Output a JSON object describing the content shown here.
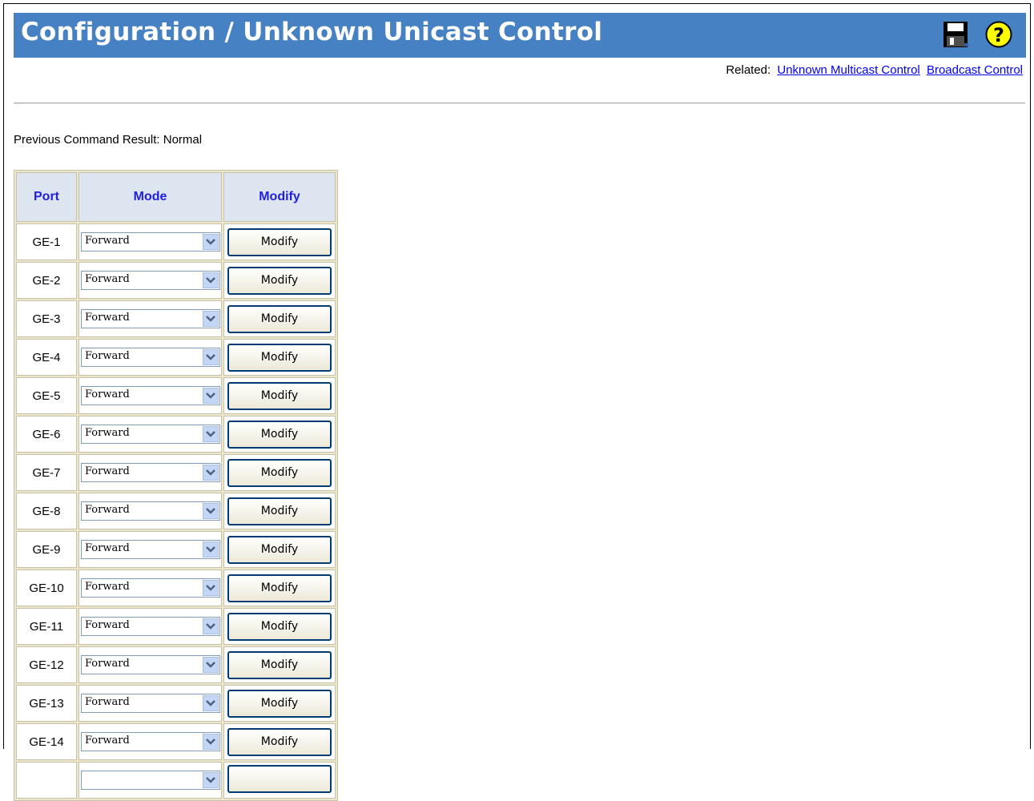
{
  "header": {
    "title": "Configuration / Unknown Unicast Control"
  },
  "related": {
    "label": "Related:",
    "links": [
      "Unknown Multicast Control",
      "Broadcast Control"
    ]
  },
  "status": {
    "text": "Previous Command Result: Normal"
  },
  "table": {
    "columns": [
      "Port",
      "Mode",
      "Modify"
    ],
    "rows": [
      {
        "port": "GE-1",
        "mode": "Forward",
        "action": "Modify"
      },
      {
        "port": "GE-2",
        "mode": "Forward",
        "action": "Modify"
      },
      {
        "port": "GE-3",
        "mode": "Forward",
        "action": "Modify"
      },
      {
        "port": "GE-4",
        "mode": "Forward",
        "action": "Modify"
      },
      {
        "port": "GE-5",
        "mode": "Forward",
        "action": "Modify"
      },
      {
        "port": "GE-6",
        "mode": "Forward",
        "action": "Modify"
      },
      {
        "port": "GE-7",
        "mode": "Forward",
        "action": "Modify"
      },
      {
        "port": "GE-8",
        "mode": "Forward",
        "action": "Modify"
      },
      {
        "port": "GE-9",
        "mode": "Forward",
        "action": "Modify"
      },
      {
        "port": "GE-10",
        "mode": "Forward",
        "action": "Modify"
      },
      {
        "port": "GE-11",
        "mode": "Forward",
        "action": "Modify"
      },
      {
        "port": "GE-12",
        "mode": "Forward",
        "action": "Modify"
      },
      {
        "port": "GE-13",
        "mode": "Forward",
        "action": "Modify"
      },
      {
        "port": "GE-14",
        "mode": "Forward",
        "action": "Modify"
      },
      {
        "port": "",
        "mode": "",
        "action": ""
      }
    ]
  },
  "colors": {
    "title_bar": "#4682c3",
    "header_text": "#2020e0",
    "link": "#0000ee"
  },
  "icons": {
    "save": "floppy-disk-icon",
    "help": "question-mark-icon"
  }
}
